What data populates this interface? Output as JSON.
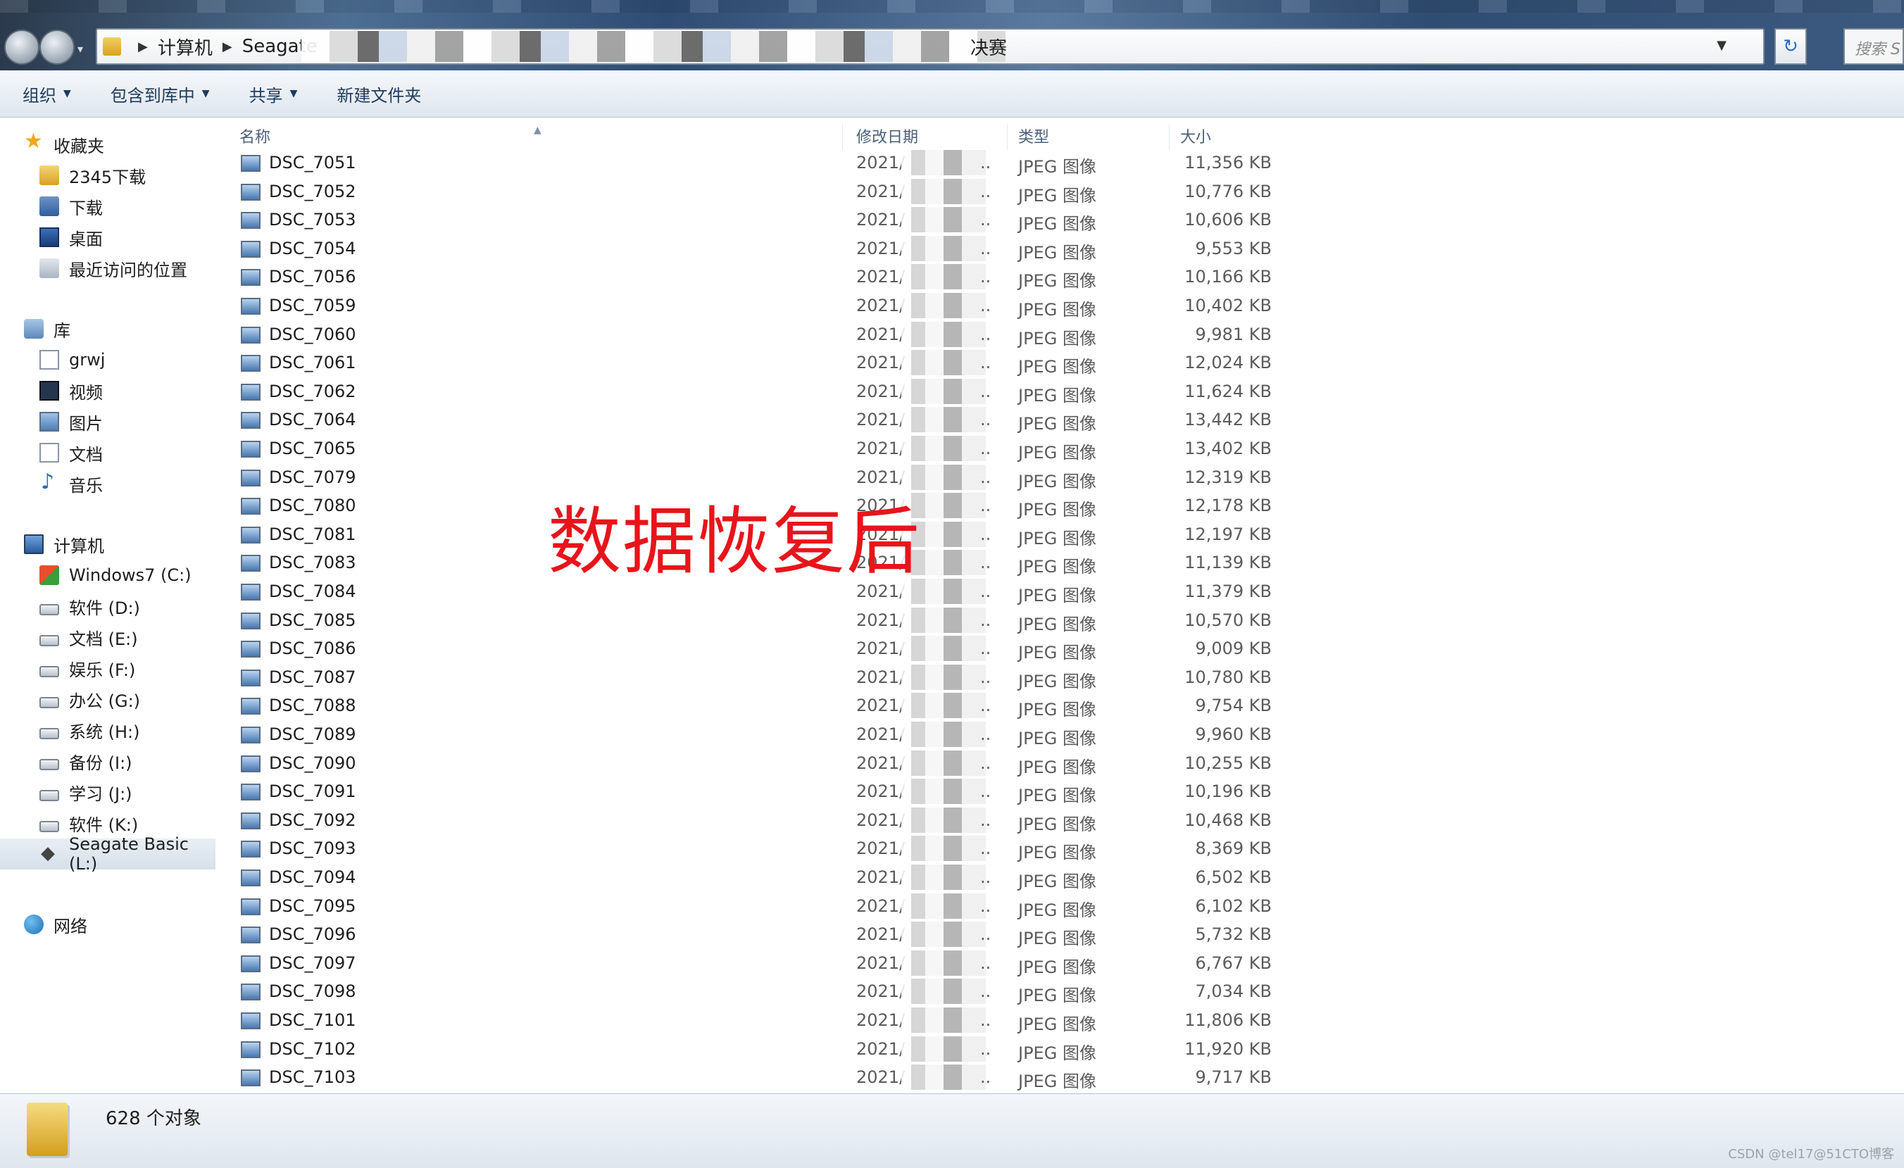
{
  "address": {
    "crumbs": [
      "计算机",
      "Seagate"
    ],
    "tail": "决赛"
  },
  "search_placeholder": "搜索 S",
  "toolbar": {
    "items": [
      {
        "label": "组织",
        "has_arrow": true
      },
      {
        "label": "包含到库中",
        "has_arrow": true
      },
      {
        "label": "共享",
        "has_arrow": true
      },
      {
        "label": "新建文件夹",
        "has_arrow": false
      }
    ]
  },
  "sidebar": {
    "favorites": {
      "label": "收藏夹",
      "items": [
        "2345下载",
        "下载",
        "桌面",
        "最近访问的位置"
      ]
    },
    "libraries": {
      "label": "库",
      "items": [
        "grwj",
        "视频",
        "图片",
        "文档",
        "音乐"
      ]
    },
    "computer": {
      "label": "计算机",
      "items": [
        "Windows7 (C:)",
        "软件 (D:)",
        "文档 (E:)",
        "娱乐 (F:)",
        "办公 (G:)",
        "系统 (H:)",
        "备份 (I:)",
        "学习 (J:)",
        "软件 (K:)",
        "Seagate Basic (L:)"
      ],
      "selected": "Seagate Basic (L:)"
    },
    "network": {
      "label": "网络"
    }
  },
  "columns": {
    "name": "名称",
    "date": "修改日期",
    "type": "类型",
    "size": "大小"
  },
  "files": [
    {
      "name": "DSC_7051",
      "date": "2021/",
      "type": "JPEG 图像",
      "size": "11,356 KB"
    },
    {
      "name": "DSC_7052",
      "date": "2021/",
      "type": "JPEG 图像",
      "size": "10,776 KB"
    },
    {
      "name": "DSC_7053",
      "date": "2021/",
      "type": "JPEG 图像",
      "size": "10,606 KB"
    },
    {
      "name": "DSC_7054",
      "date": "2021/",
      "type": "JPEG 图像",
      "size": "9,553 KB"
    },
    {
      "name": "DSC_7056",
      "date": "2021/",
      "type": "JPEG 图像",
      "size": "10,166 KB"
    },
    {
      "name": "DSC_7059",
      "date": "2021/",
      "type": "JPEG 图像",
      "size": "10,402 KB"
    },
    {
      "name": "DSC_7060",
      "date": "2021/",
      "type": "JPEG 图像",
      "size": "9,981 KB"
    },
    {
      "name": "DSC_7061",
      "date": "2021/",
      "type": "JPEG 图像",
      "size": "12,024 KB"
    },
    {
      "name": "DSC_7062",
      "date": "2021/",
      "type": "JPEG 图像",
      "size": "11,624 KB"
    },
    {
      "name": "DSC_7064",
      "date": "2021/",
      "type": "JPEG 图像",
      "size": "13,442 KB"
    },
    {
      "name": "DSC_7065",
      "date": "2021/",
      "type": "JPEG 图像",
      "size": "13,402 KB"
    },
    {
      "name": "DSC_7079",
      "date": "2021/",
      "type": "JPEG 图像",
      "size": "12,319 KB"
    },
    {
      "name": "DSC_7080",
      "date": "2021/",
      "type": "JPEG 图像",
      "size": "12,178 KB"
    },
    {
      "name": "DSC_7081",
      "date": "2021/",
      "type": "JPEG 图像",
      "size": "12,197 KB"
    },
    {
      "name": "DSC_7083",
      "date": "2021/",
      "type": "JPEG 图像",
      "size": "11,139 KB"
    },
    {
      "name": "DSC_7084",
      "date": "2021/",
      "type": "JPEG 图像",
      "size": "11,379 KB"
    },
    {
      "name": "DSC_7085",
      "date": "2021/",
      "type": "JPEG 图像",
      "size": "10,570 KB"
    },
    {
      "name": "DSC_7086",
      "date": "2021/",
      "type": "JPEG 图像",
      "size": "9,009 KB"
    },
    {
      "name": "DSC_7087",
      "date": "2021/",
      "type": "JPEG 图像",
      "size": "10,780 KB"
    },
    {
      "name": "DSC_7088",
      "date": "2021/",
      "type": "JPEG 图像",
      "size": "9,754 KB"
    },
    {
      "name": "DSC_7089",
      "date": "2021/",
      "type": "JPEG 图像",
      "size": "9,960 KB"
    },
    {
      "name": "DSC_7090",
      "date": "2021/",
      "type": "JPEG 图像",
      "size": "10,255 KB"
    },
    {
      "name": "DSC_7091",
      "date": "2021/",
      "type": "JPEG 图像",
      "size": "10,196 KB"
    },
    {
      "name": "DSC_7092",
      "date": "2021/",
      "type": "JPEG 图像",
      "size": "10,468 KB"
    },
    {
      "name": "DSC_7093",
      "date": "2021/",
      "type": "JPEG 图像",
      "size": "8,369 KB"
    },
    {
      "name": "DSC_7094",
      "date": "2021/",
      "type": "JPEG 图像",
      "size": "6,502 KB"
    },
    {
      "name": "DSC_7095",
      "date": "2021/",
      "type": "JPEG 图像",
      "size": "6,102 KB"
    },
    {
      "name": "DSC_7096",
      "date": "2021/",
      "type": "JPEG 图像",
      "size": "5,732 KB"
    },
    {
      "name": "DSC_7097",
      "date": "2021/",
      "type": "JPEG 图像",
      "size": "6,767 KB"
    },
    {
      "name": "DSC_7098",
      "date": "2021/",
      "type": "JPEG 图像",
      "size": "7,034 KB"
    },
    {
      "name": "DSC_7101",
      "date": "2021/",
      "type": "JPEG 图像",
      "size": "11,806 KB"
    },
    {
      "name": "DSC_7102",
      "date": "2021/",
      "type": "JPEG 图像",
      "size": "11,920 KB"
    },
    {
      "name": "DSC_7103",
      "date": "2021/",
      "type": "JPEG 图像",
      "size": "9,717 KB"
    }
  ],
  "overlay_label": "数据恢复后",
  "status": {
    "count": "628 个对象"
  },
  "watermark": "CSDN @tel17@51CTO博客"
}
